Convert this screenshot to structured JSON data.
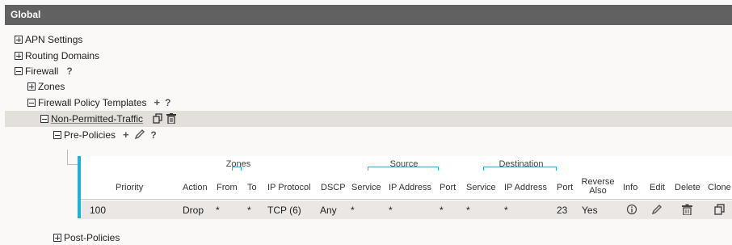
{
  "panel_title": "Global",
  "tree": {
    "apn_settings": "APN Settings",
    "routing_domains": "Routing Domains",
    "firewall": "Firewall",
    "zones": "Zones",
    "policy_templates": "Firewall Policy Templates",
    "template_name": "Non-Permitted-Traffic",
    "pre_policies": "Pre-Policies",
    "post_policies": "Post-Policies",
    "help_glyph": "?",
    "add_glyph": "+"
  },
  "table": {
    "groups": {
      "zones": "Zones",
      "source": "Source",
      "destination": "Destination"
    },
    "headers": {
      "priority": "Priority",
      "action": "Action",
      "from": "From",
      "to": "To",
      "ip_protocol": "IP Protocol",
      "dscp": "DSCP",
      "src_service": "Service",
      "src_ip": "IP Address",
      "src_port": "Port",
      "dst_service": "Service",
      "dst_ip": "IP Address",
      "dst_port": "Port",
      "reverse_1": "Reverse",
      "reverse_2": "Also",
      "info": "Info",
      "edit": "Edit",
      "delete": "Delete",
      "clone": "Clone"
    },
    "row": {
      "priority": "100",
      "action": "Drop",
      "from": "*",
      "to": "*",
      "ip_protocol": "TCP (6)",
      "dscp": "Any",
      "src_service": "*",
      "src_ip": "*",
      "src_port": "*",
      "dst_service": "*",
      "dst_ip": "*",
      "dst_port": "23",
      "reverse_also": "Yes"
    },
    "icons": [
      "info-icon",
      "edit-pencil-icon",
      "delete-trash-icon",
      "clone-copy-icon"
    ]
  },
  "colors": {
    "title_bar": "#616161",
    "accent": "#1db3d8",
    "row_bg": "#ebe7e4",
    "selected_bg": "#e3dfdb"
  }
}
